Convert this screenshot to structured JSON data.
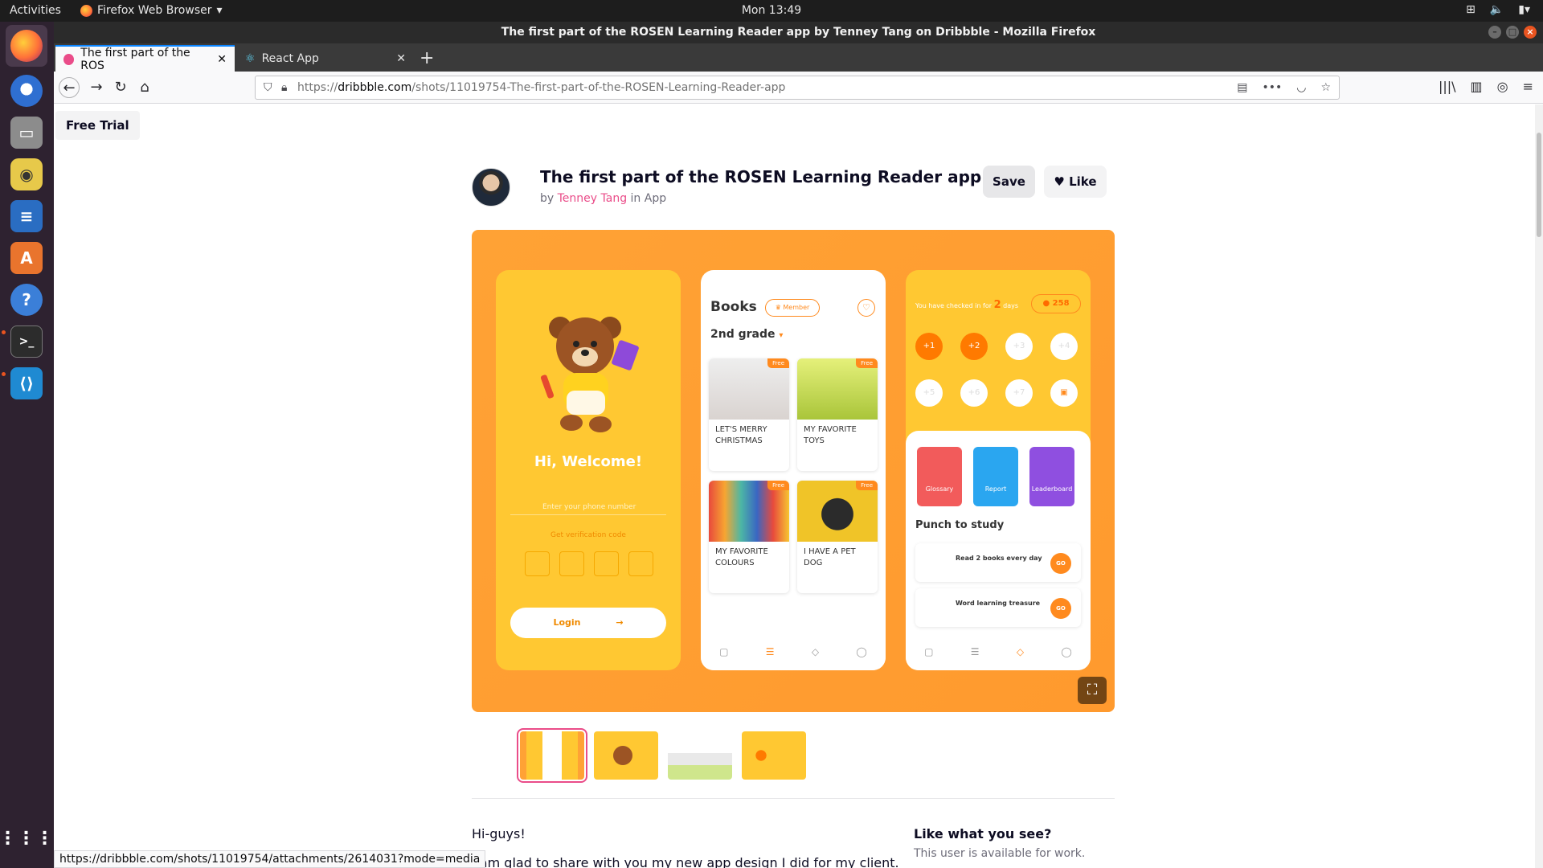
{
  "system": {
    "activities": "Activities",
    "app_name": "Firefox Web Browser",
    "clock": "Mon 13:49"
  },
  "window": {
    "title": "The first part of the ROSEN Learning Reader app by Tenney Tang on Dribbble - Mozilla Firefox"
  },
  "tabs": [
    {
      "label": "The first part of the ROS"
    },
    {
      "label": "React App"
    }
  ],
  "url": {
    "scheme": "https://",
    "host": "dribbble.com",
    "path": "/shots/11019754-The-first-part-of-the-ROSEN-Learning-Reader-app"
  },
  "page": {
    "free_trial": "Free Trial",
    "shot_title": "The first part of the ROSEN Learning Reader app",
    "by": "by",
    "author": "Tenney Tang",
    "in": "in",
    "category": "App",
    "save_label": "Save",
    "like_label": "Like",
    "desc_greeting": "Hi-guys!",
    "desc_line": "I am glad to share with you my new app design I did for my client.",
    "like_what": "Like what you see?",
    "available": "This user is available for work."
  },
  "mockup": {
    "welcome": "Hi, Welcome!",
    "phone_placeholder": "Enter your phone number",
    "verify": "Get verification code",
    "login": "Login",
    "books_title": "Books",
    "member": "Member",
    "grade": "2nd grade",
    "books": [
      {
        "title": "LET'S MERRY CHRISTMAS",
        "tag": "Free"
      },
      {
        "title": "MY FAVORITE TOYS",
        "tag": "Free"
      },
      {
        "title": "MY FAVORITE COLOURS",
        "tag": "Free"
      },
      {
        "title": "I HAVE A PET DOG",
        "tag": "Free"
      }
    ],
    "checkin_pre": "You have checked in for",
    "checkin_days": "2",
    "checkin_post": "days",
    "coins": "258",
    "days": [
      "+1",
      "+2",
      "+3",
      "+4",
      "+5",
      "+6",
      "+7"
    ],
    "tiles": [
      "Glossary",
      "Report",
      "Leaderboard"
    ],
    "punch": "Punch to study",
    "tasks": [
      "Read 2 books every day",
      "Word learning treasure"
    ],
    "go": "GO"
  },
  "status_url": "https://dribbble.com/shots/11019754/attachments/2614031?mode=media",
  "colors": {
    "accent_pink": "#ea4c89",
    "hero_orange": "#ffa235",
    "ubuntu_orange": "#e95420"
  }
}
